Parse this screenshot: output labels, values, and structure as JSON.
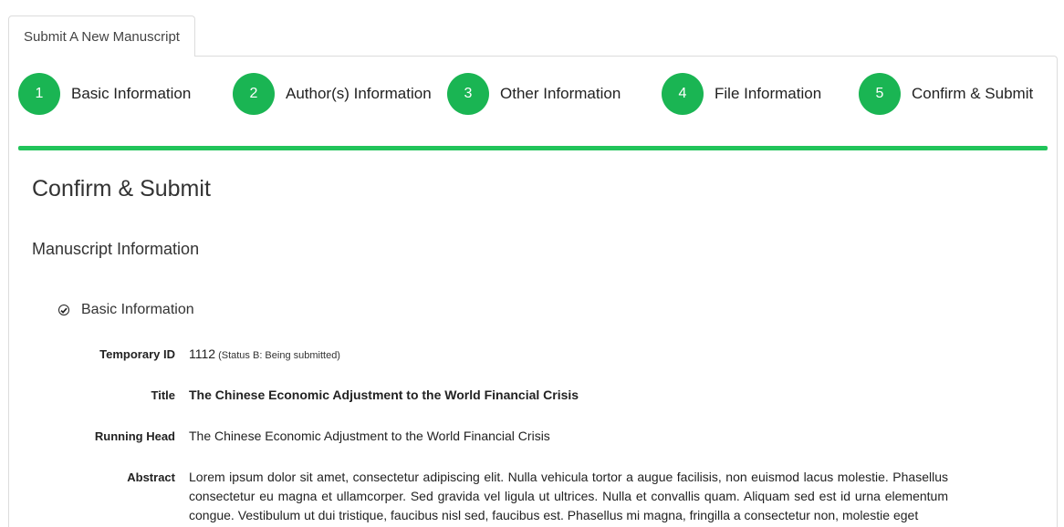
{
  "tab": {
    "label": "Submit A New Manuscript"
  },
  "steps": [
    {
      "num": "1",
      "label": "Basic Information"
    },
    {
      "num": "2",
      "label": "Author(s) Information"
    },
    {
      "num": "3",
      "label": "Other Information"
    },
    {
      "num": "4",
      "label": "File Information"
    },
    {
      "num": "5",
      "label": "Confirm & Submit"
    }
  ],
  "colors": {
    "step_circle": "#1ab553",
    "progress_bar": "#21c45a"
  },
  "progress": 1.0,
  "page": {
    "heading": "Confirm & Submit",
    "subheading": "Manuscript Information",
    "section": {
      "label": "Basic Information",
      "icon": "check-circle-icon"
    }
  },
  "fields": {
    "temp_id": {
      "label": "Temporary ID",
      "value": "1112",
      "status": "(Status B: Being submitted)"
    },
    "title": {
      "label": "Title",
      "value": "The Chinese Economic Adjustment to the World Financial Crisis"
    },
    "running_head": {
      "label": "Running Head",
      "value": "The Chinese Economic Adjustment to the World Financial Crisis"
    },
    "abstract": {
      "label": "Abstract",
      "value": "Lorem ipsum dolor sit amet, consectetur adipiscing elit. Nulla vehicula tortor a augue facilisis, non euismod lacus molestie. Phasellus consectetur eu magna et ullamcorper. Sed gravida vel ligula ut ultrices. Nulla et convallis quam. Aliquam sed est id urna elementum congue. Vestibulum ut dui tristique, faucibus nisl sed, faucibus est. Phasellus mi magna, fringilla a consectetur non, molestie eget"
    }
  }
}
